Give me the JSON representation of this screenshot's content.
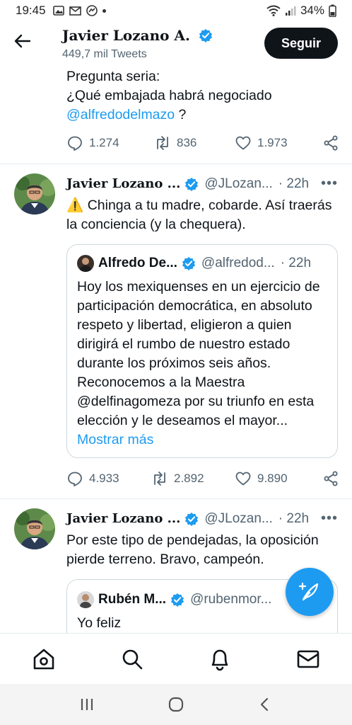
{
  "status_bar": {
    "time": "19:45",
    "battery": "34%"
  },
  "header": {
    "name": "Javier Lozano A.",
    "tweet_count": "449,7 mil Tweets",
    "follow_label": "Seguir"
  },
  "tweet1": {
    "line1": "Pregunta seria:",
    "line2": "¿Qué embajada habrá negociado",
    "mention": "@alfredodelmazo",
    "after_mention": " ?",
    "replies": "1.274",
    "retweets": "836",
    "likes": "1.973"
  },
  "tweet2": {
    "name": "Javier Lozano ...",
    "handle": "@JLozan...",
    "time": "· 22h",
    "warning": "⚠️",
    "text": " Chinga a tu madre, cobarde. Así traerás la conciencia (y la chequera).",
    "quote": {
      "name": "Alfredo De...",
      "handle": "@alfredod...",
      "time": "· 22h",
      "text": "Hoy los mexiquenses en un ejercicio de participación democrática, en absoluto respeto y libertad, eligieron a quien dirigirá el rumbo de nuestro estado durante los próximos seis años. Reconocemos a la Maestra @delfinagomeza por su triunfo en esta elección y le deseamos el mayor...",
      "show_more": " Mostrar más"
    },
    "replies": "4.933",
    "retweets": "2.892",
    "likes": "9.890"
  },
  "tweet3": {
    "name": "Javier Lozano ...",
    "handle": "@JLozan...",
    "time": "· 22h",
    "text": "Por este tipo de pendejadas, la oposición pierde terreno. Bravo, campeón.",
    "quote": {
      "name": "Rubén M...",
      "handle": "@rubenmor...",
      "text": "Yo feliz"
    }
  },
  "colors": {
    "accent": "#1d9bf0",
    "text": "#0f1419",
    "muted": "#536471"
  }
}
